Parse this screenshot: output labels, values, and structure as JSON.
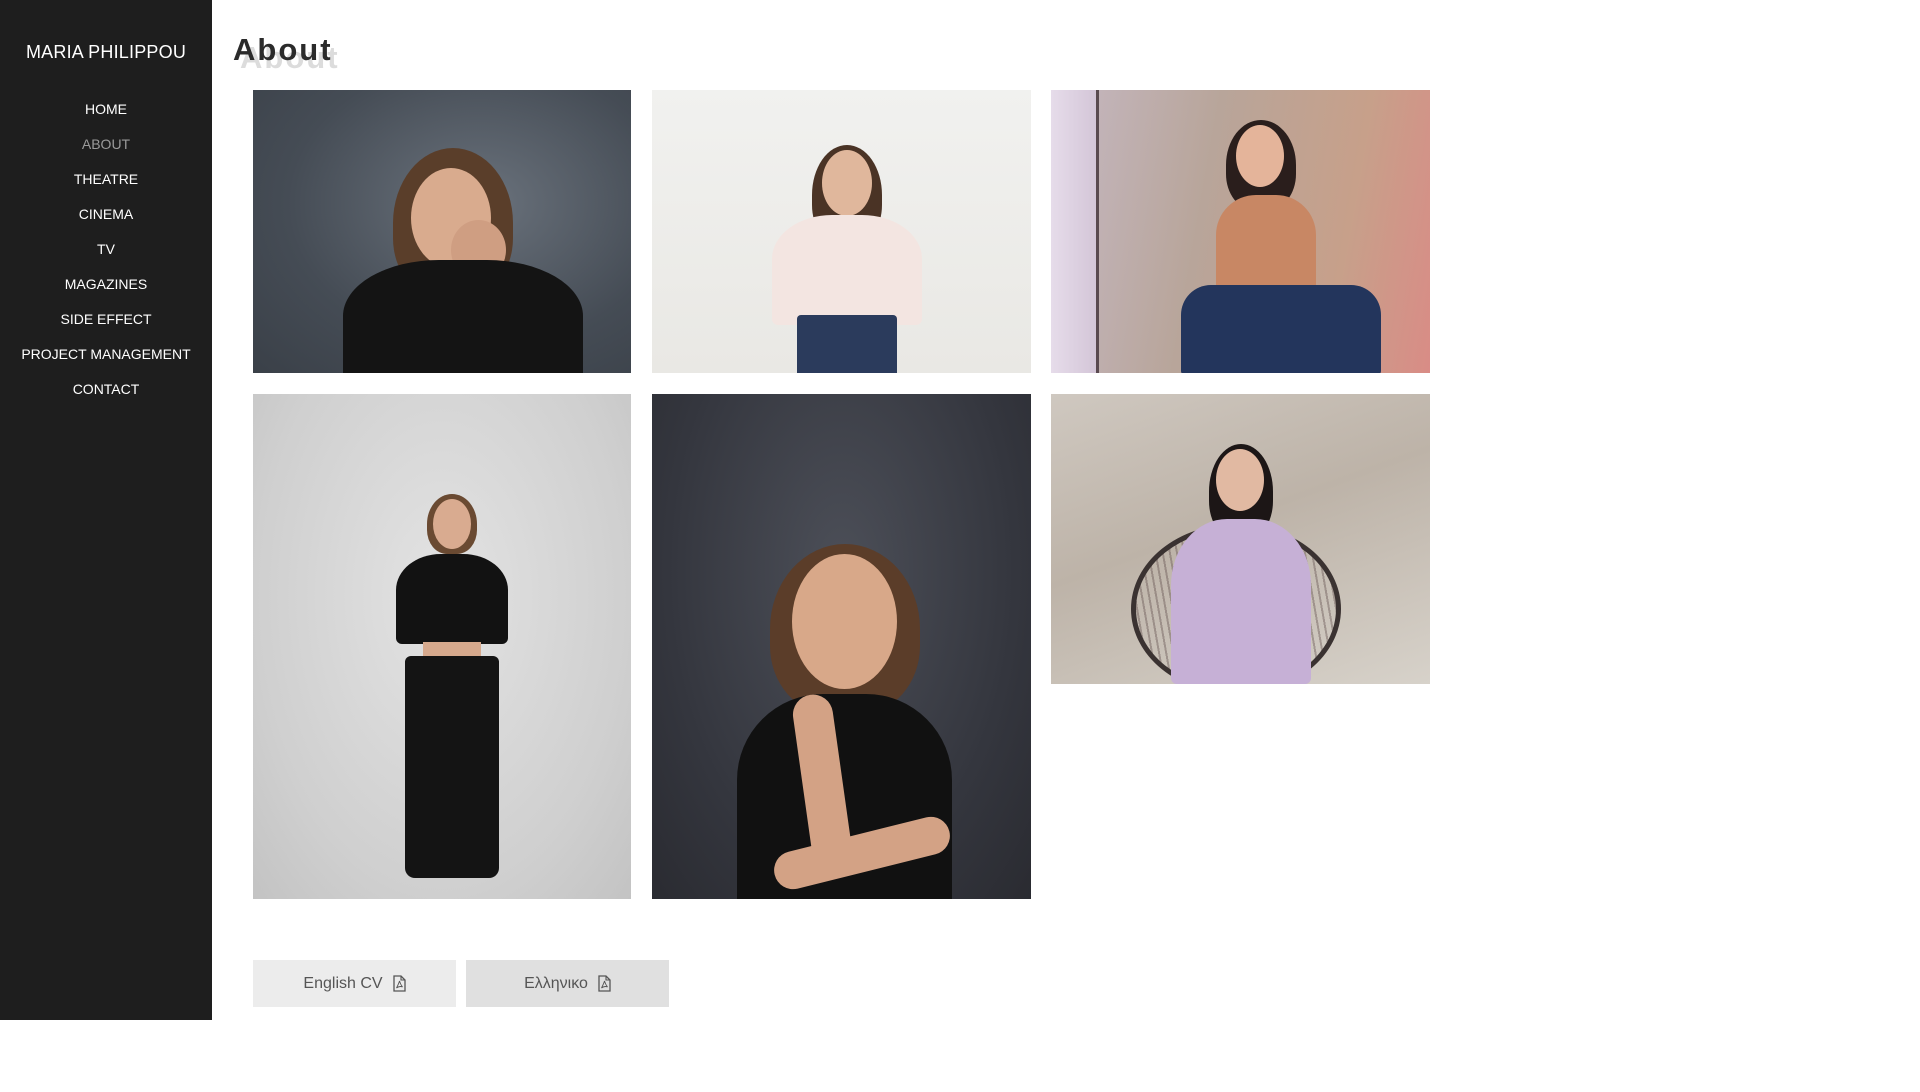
{
  "sidebar": {
    "site_title": "MARIA PHILIPPOU",
    "nav": [
      {
        "label": "HOME",
        "active": false
      },
      {
        "label": "ABOUT",
        "active": true
      },
      {
        "label": "THEATRE",
        "active": false
      },
      {
        "label": "CINEMA",
        "active": false
      },
      {
        "label": "TV",
        "active": false
      },
      {
        "label": "MAGAZINES",
        "active": false
      },
      {
        "label": "SIDE EFFECT",
        "active": false
      },
      {
        "label": "PROJECT MANAGEMENT",
        "active": false
      },
      {
        "label": "CONTACT",
        "active": false
      }
    ]
  },
  "main": {
    "page_title": "About",
    "photos": [
      {
        "icon": "portrait-photo"
      },
      {
        "icon": "portrait-photo"
      },
      {
        "icon": "portrait-photo"
      },
      {
        "icon": "portrait-photo"
      },
      {
        "icon": "portrait-photo"
      },
      {
        "icon": "portrait-photo"
      }
    ],
    "buttons": {
      "english_cv": "English CV",
      "greek_cv": "Ελληνικο",
      "icon": "pdf-file-icon"
    }
  },
  "colors": {
    "sidebar_bg": "#1e1e1e",
    "nav_text": "#ffffff",
    "nav_active": "#9a9a9a"
  }
}
